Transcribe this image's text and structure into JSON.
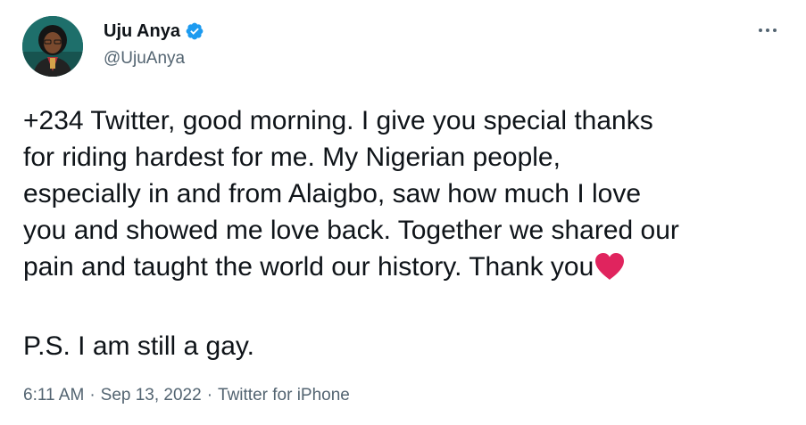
{
  "author": {
    "display_name": "Uju Anya",
    "handle": "@UjuAnya",
    "verified": true
  },
  "tweet": {
    "lines": [
      "+234 Twitter, good morning. I give you special thanks",
      "for riding hardest for me. My Nigerian people,",
      "especially in and from Alaigbo, saw how much I love",
      "you and showed me love back. Together we shared our",
      "pain and taught the world our history. Thank you"
    ],
    "emoji": "red-heart",
    "postscript": "P.S. I am still a gay."
  },
  "meta": {
    "time": "6:11 AM",
    "separator": "·",
    "date": "Sep 13, 2022",
    "source": "Twitter for iPhone"
  },
  "colors": {
    "text": "#0f1419",
    "secondary": "#536471",
    "verified": "#1d9bf0",
    "heart": "#e0245e"
  },
  "icons": [
    "verified-badge-icon",
    "more-options-icon",
    "red-heart-icon"
  ]
}
